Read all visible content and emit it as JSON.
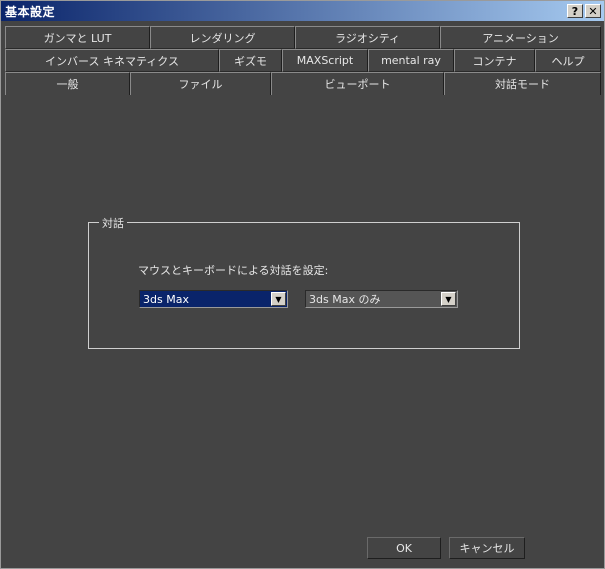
{
  "window": {
    "title": "基本設定",
    "help_label": "?",
    "close_label": "✕"
  },
  "tabs": {
    "row1": [
      "ガンマと LUT",
      "レンダリング",
      "ラジオシティ",
      "アニメーション"
    ],
    "row2": [
      "インバース キネマティクス",
      "ギズモ",
      "MAXScript",
      "mental ray",
      "コンテナ",
      "ヘルプ"
    ],
    "row3": [
      "一般",
      "ファイル",
      "ビューポート",
      "対話モード"
    ],
    "active": "対話モード"
  },
  "group": {
    "title": "対話",
    "label": "マウスとキーボードによる対話を設定:",
    "combo1_value": "3ds Max",
    "combo2_value": "3ds Max のみ"
  },
  "buttons": {
    "ok": "OK",
    "cancel": "キャンセル"
  },
  "colors": {
    "background": "#444444",
    "titlebar_start": "#0a246a",
    "titlebar_end": "#a6caf0",
    "selection": "#0a246a"
  },
  "icons": {
    "dropdown_arrow": "chevron-down-icon",
    "help": "help-icon",
    "close": "close-icon"
  }
}
